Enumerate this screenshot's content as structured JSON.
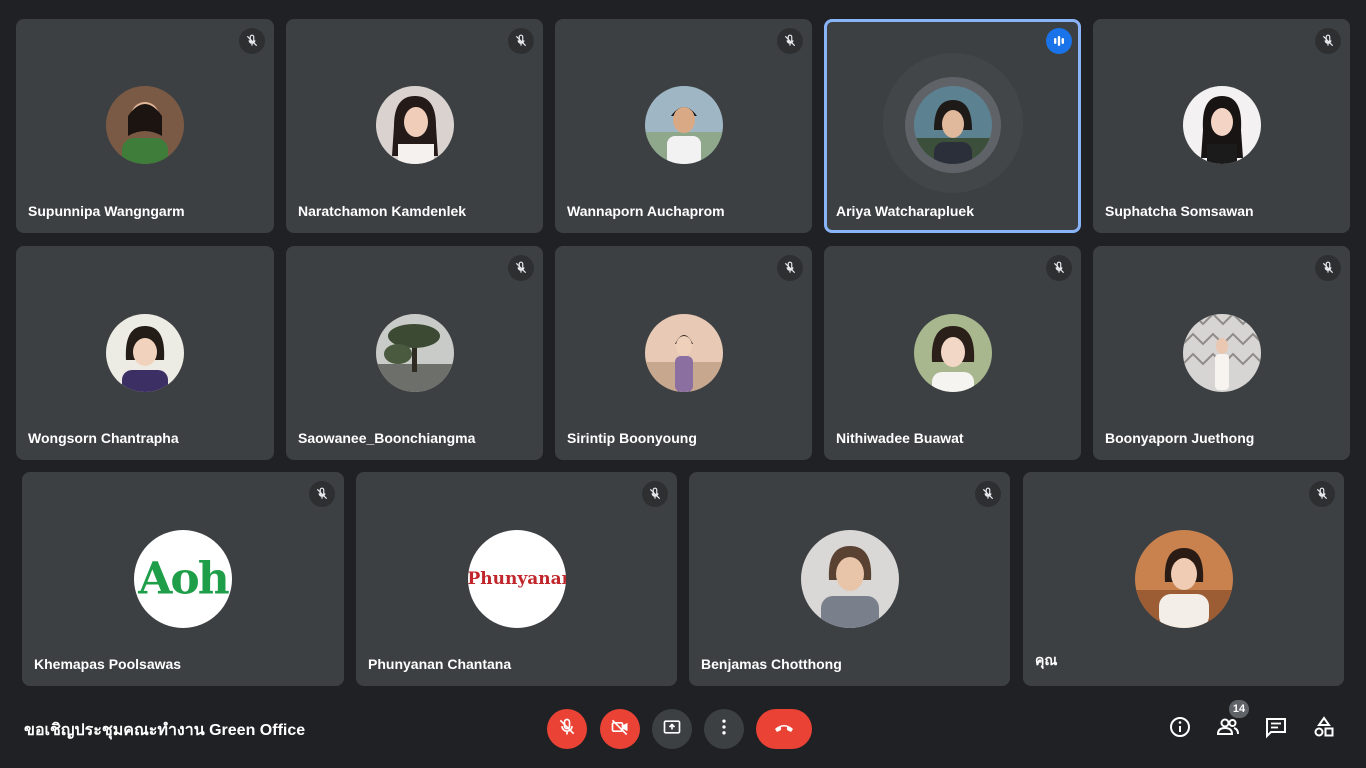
{
  "participants": [
    {
      "name": "Supunnipa Wangngarm",
      "muted": true
    },
    {
      "name": "Naratchamon Kamdenlek",
      "muted": true
    },
    {
      "name": "Wannaporn Auchaprom",
      "muted": true
    },
    {
      "name": "Ariya Watcharapluek",
      "muted": false,
      "speaking": true
    },
    {
      "name": "Suphatcha Somsawan",
      "muted": true
    },
    {
      "name": "Wongsorn Chantrapha",
      "muted": false
    },
    {
      "name": "Saowanee_Boonchiangma",
      "muted": true
    },
    {
      "name": "Sirintip Boonyoung",
      "muted": true
    },
    {
      "name": "Nithiwadee Buawat",
      "muted": true
    },
    {
      "name": "Boonyaporn Juethong",
      "muted": true
    },
    {
      "name": "Khemapas Poolsawas",
      "muted": true,
      "avatar_text": "Aoh"
    },
    {
      "name": "Phunyanan Chantana",
      "muted": true,
      "avatar_text": "Phunyanan"
    },
    {
      "name": "Benjamas Chotthong",
      "muted": true
    },
    {
      "name": "คุณ",
      "muted": true
    }
  ],
  "meeting": {
    "title": "ขอเชิญประชุมคณะทำงาน Green Office"
  },
  "controls": {
    "icons": [
      "mic-off-icon",
      "camera-off-icon",
      "present-screen-icon",
      "more-options-icon",
      "end-call-icon"
    ]
  },
  "side_controls": {
    "icons": [
      "info-icon",
      "people-icon",
      "chat-icon",
      "activities-icon"
    ],
    "people_count": "14"
  },
  "colors": {
    "background": "#202124",
    "tile": "#3c4043",
    "active_border": "#8ab4f8",
    "red": "#ea4335",
    "speaking": "#1a73e8"
  }
}
